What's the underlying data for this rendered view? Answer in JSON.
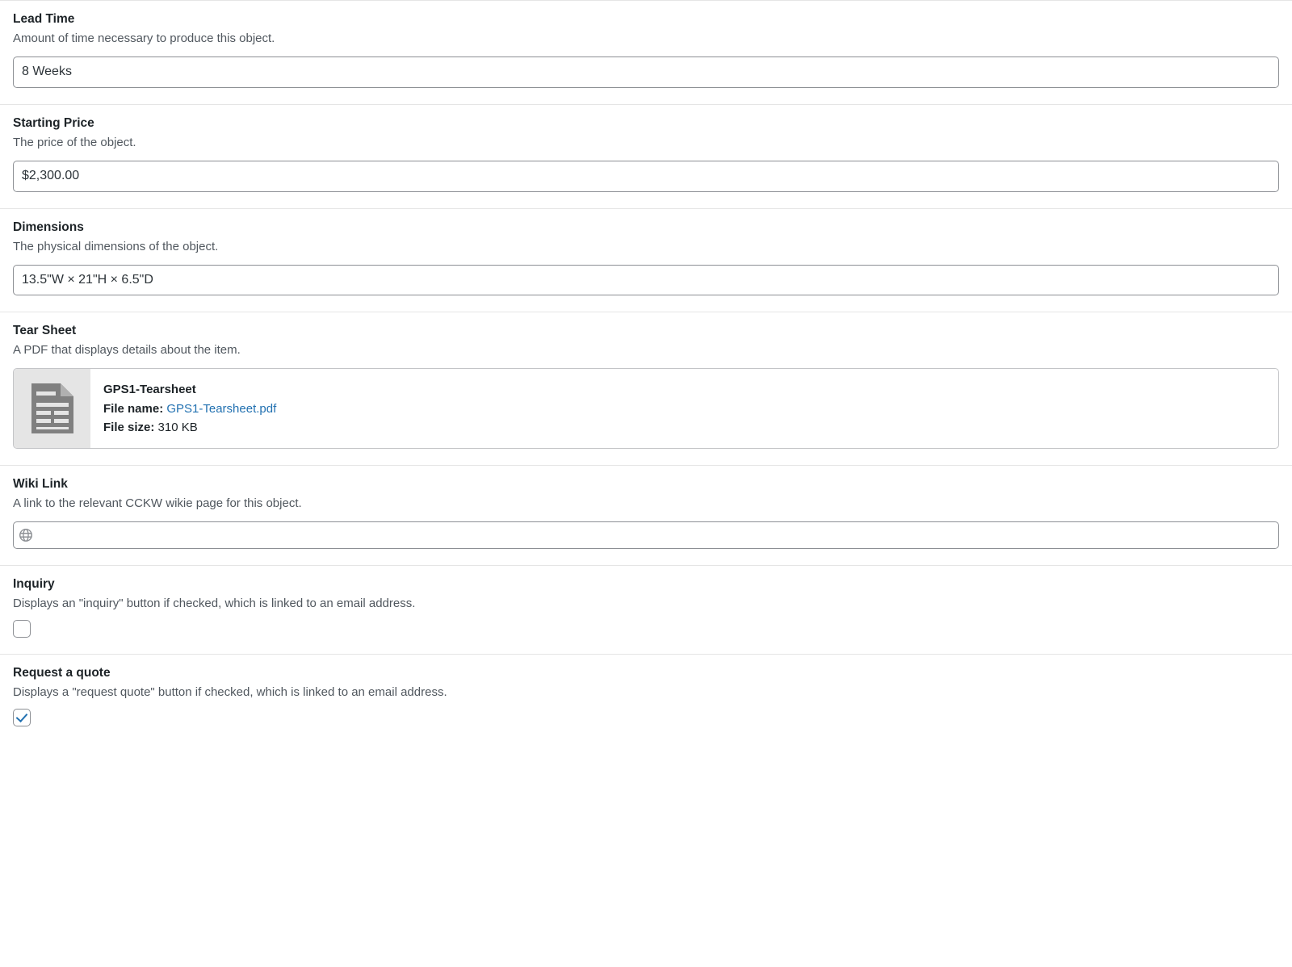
{
  "fields": {
    "leadTime": {
      "label": "Lead Time",
      "description": "Amount of time necessary to produce this object.",
      "value": "8 Weeks"
    },
    "startingPrice": {
      "label": "Starting Price",
      "description": "The price of the object.",
      "value": "$2,300.00"
    },
    "dimensions": {
      "label": "Dimensions",
      "description": "The physical dimensions of the object.",
      "value": "13.5\"W × 21\"H × 6.5\"D"
    },
    "tearSheet": {
      "label": "Tear Sheet",
      "description": "A PDF that displays details about the item.",
      "file": {
        "title": "GPS1-Tearsheet",
        "fileNameLabel": "File name:",
        "fileName": "GPS1-Tearsheet.pdf",
        "fileSizeLabel": "File size:",
        "fileSize": "310 KB"
      }
    },
    "wikiLink": {
      "label": "Wiki Link",
      "description": "A link to the relevant CCKW wikie page for this object.",
      "value": ""
    },
    "inquiry": {
      "label": "Inquiry",
      "description": "Displays an \"inquiry\" button if checked, which is linked to an email address.",
      "checked": false
    },
    "requestQuote": {
      "label": "Request a quote",
      "description": "Displays a \"request quote\" button if checked, which is linked to an email address.",
      "checked": true
    }
  }
}
